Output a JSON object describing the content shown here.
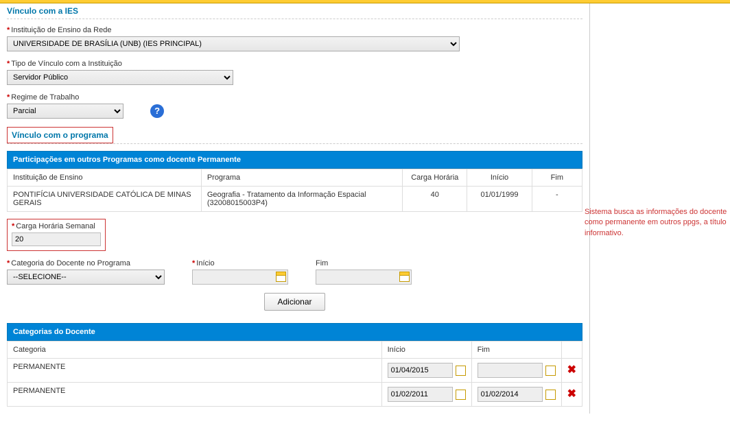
{
  "vinculo_ies": {
    "title": "Vínculo com a IES",
    "instituicao_label": "Instituição de Ensino da Rede",
    "instituicao_value": "UNIVERSIDADE DE BRASÍLIA (UNB) (IES PRINCIPAL)",
    "tipo_vinculo_label": "Tipo de Vínculo com a Instituição",
    "tipo_vinculo_value": "Servidor Público",
    "regime_label": "Regime de Trabalho",
    "regime_value": "Parcial"
  },
  "vinculo_programa": {
    "title": "Vínculo com o programa",
    "participacoes_title": "Participações em outros Programas como docente Permanente",
    "headers": {
      "instituicao": "Instituição de Ensino",
      "programa": "Programa",
      "carga": "Carga Horária",
      "inicio": "Início",
      "fim": "Fim"
    },
    "row": {
      "instituicao": "PONTIFÍCIA UNIVERSIDADE CATÓLICA DE MINAS GERAIS",
      "programa": "Geografia - Tratamento da Informação Espacial (32008015003P4)",
      "carga": "40",
      "inicio": "01/01/1999",
      "fim": "-"
    },
    "carga_semanal_label": "Carga Horária Semanal",
    "carga_semanal_value": "20",
    "categoria_label": "Categoria do Docente no Programa",
    "categoria_value": "--SELECIONE--",
    "inicio_label": "Início",
    "fim_label": "Fim",
    "adicionar_label": "Adicionar"
  },
  "categorias": {
    "title": "Categorias do Docente",
    "headers": {
      "categoria": "Categoria",
      "inicio": "Início",
      "fim": "Fim"
    },
    "rows": [
      {
        "categoria": "PERMANENTE",
        "inicio": "01/04/2015",
        "fim": ""
      },
      {
        "categoria": "PERMANENTE",
        "inicio": "01/02/2011",
        "fim": "01/02/2014"
      }
    ]
  },
  "annotation": "Sistema busca as informações do docente como permanente em outros ppgs, a título informativo."
}
